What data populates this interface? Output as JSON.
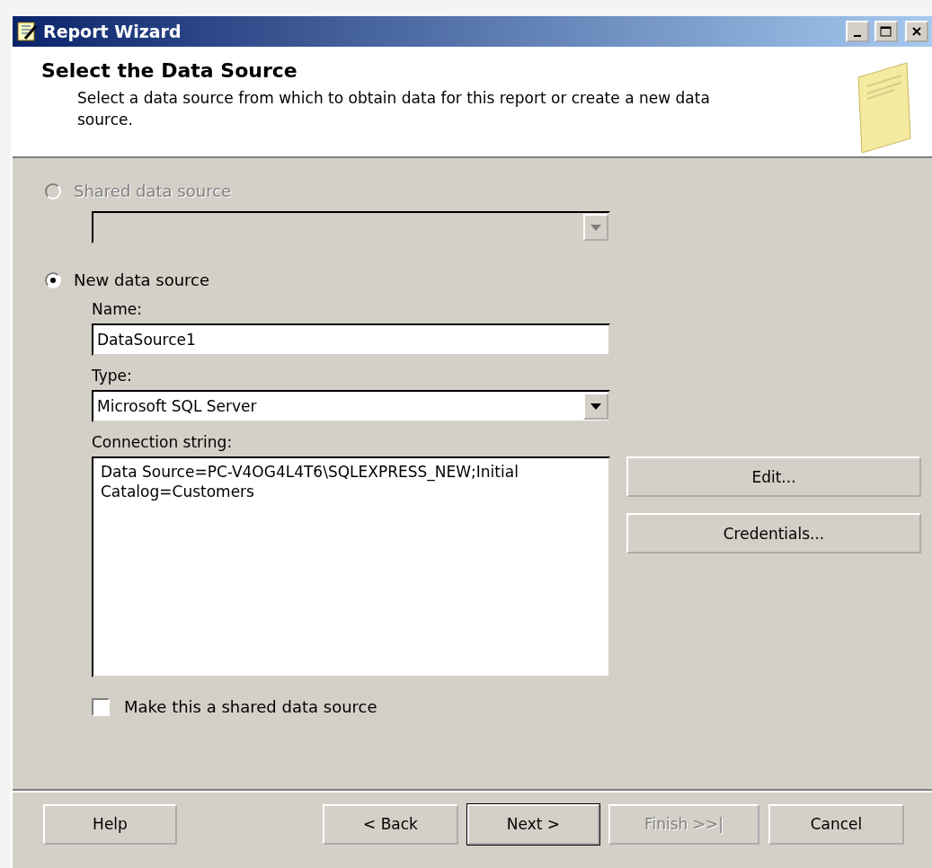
{
  "window": {
    "title": "Report Wizard"
  },
  "header": {
    "title": "Select the Data Source",
    "description": "Select a data source from which to obtain data for this report or create a new data source."
  },
  "shared_source": {
    "label": "Shared data source",
    "selected": false,
    "disabled": true
  },
  "shared_combo": {
    "disabled": true
  },
  "new_source": {
    "label": "New data source",
    "selected": true,
    "disabled": false
  },
  "name": {
    "label": "Name:",
    "value": "DataSource1"
  },
  "type": {
    "label": "Type:",
    "value": "Microsoft SQL Server"
  },
  "connection": {
    "label": "Connection string:",
    "value": "Data Source=PC-V4OG4L4T6\\SQLEXPRESS_NEW;Initial Catalog=Customers"
  },
  "side_buttons": [
    {
      "label": "Edit..."
    },
    {
      "label": "Credentials..."
    }
  ],
  "shared_checkbox": {
    "label": "Make this a shared data source",
    "checked": false
  },
  "footer_buttons": [
    {
      "label": "Help",
      "kind": "help",
      "disabled": false,
      "default": false
    },
    {
      "label": "< Back",
      "kind": "nav",
      "disabled": false,
      "default": false
    },
    {
      "label": "Next >",
      "kind": "nav",
      "disabled": false,
      "default": true
    },
    {
      "label": "Finish >>|",
      "kind": "nav",
      "disabled": true,
      "default": false
    },
    {
      "label": "Cancel",
      "kind": "nav",
      "disabled": false,
      "default": false
    }
  ]
}
